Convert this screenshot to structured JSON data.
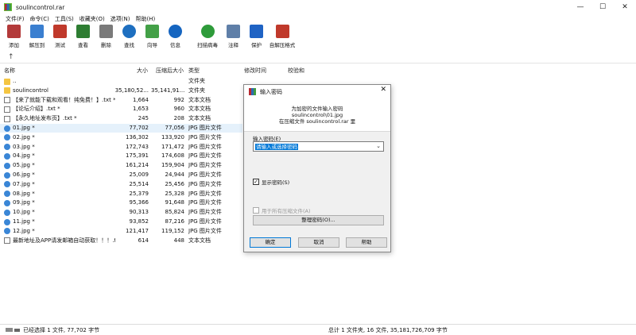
{
  "window": {
    "title": "soulincontrol.rar",
    "min": "—",
    "max": "☐",
    "close": "✕"
  },
  "menu": [
    "文件(F)",
    "命令(C)",
    "工具(S)",
    "收藏夹(O)",
    "选项(N)",
    "帮助(H)"
  ],
  "toolbar": [
    {
      "label": "添加",
      "icon": "add-archive-icon",
      "color": "#b33a3a"
    },
    {
      "label": "解压到",
      "icon": "extract-folder-icon",
      "color": "#3a7fd0"
    },
    {
      "label": "测试",
      "icon": "test-icon",
      "color": "#c0392b"
    },
    {
      "label": "查看",
      "icon": "view-book-icon",
      "color": "#2e7d32"
    },
    {
      "label": "删除",
      "icon": "trash-icon",
      "color": "#7a7a7a"
    },
    {
      "label": "查找",
      "icon": "find-magnifier-icon",
      "color": "#1e6fc0"
    },
    {
      "label": "向导",
      "icon": "wizard-wand-icon",
      "color": "#43a047"
    },
    {
      "label": "信息",
      "icon": "info-icon",
      "color": "#1565c0"
    },
    {
      "label": "扫描病毒",
      "icon": "virus-scan-icon",
      "color": "#2e9b3a"
    },
    {
      "label": "注释",
      "icon": "comment-icon",
      "color": "#5f7fa8"
    },
    {
      "label": "保护",
      "icon": "shield-icon",
      "color": "#1f63c4"
    },
    {
      "label": "自解压格式",
      "icon": "sfx-icon",
      "color": "#c0392b"
    }
  ],
  "columns": {
    "name": "名称",
    "size": "大小",
    "packed": "压缩后大小",
    "type": "类型",
    "modified": "修改时间",
    "crc": "校验和"
  },
  "files": [
    {
      "name": "..",
      "size": "",
      "packed": "",
      "type": "文件夹",
      "kind": "folder"
    },
    {
      "name": "soulincontrol",
      "size": "35,180,52...",
      "packed": "35,141,91...",
      "type": "文件夹",
      "kind": "folder"
    },
    {
      "name": "【来了就能下载和观看！纯免费！】.txt *",
      "size": "1,664",
      "packed": "992",
      "type": "文本文档",
      "kind": "txt"
    },
    {
      "name": "【论坛介绍】.txt *",
      "size": "1,653",
      "packed": "960",
      "type": "文本文档",
      "kind": "txt"
    },
    {
      "name": "【永久地址发布页】.txt *",
      "size": "245",
      "packed": "208",
      "type": "文本文档",
      "kind": "txt"
    },
    {
      "name": "01.jpg *",
      "size": "77,702",
      "packed": "77,056",
      "type": "JPG 图片文件",
      "kind": "jpg"
    },
    {
      "name": "02.jpg *",
      "size": "136,302",
      "packed": "133,920",
      "type": "JPG 图片文件",
      "kind": "jpg"
    },
    {
      "name": "03.jpg *",
      "size": "172,743",
      "packed": "171,472",
      "type": "JPG 图片文件",
      "kind": "jpg"
    },
    {
      "name": "04.jpg *",
      "size": "175,391",
      "packed": "174,608",
      "type": "JPG 图片文件",
      "kind": "jpg"
    },
    {
      "name": "05.jpg *",
      "size": "161,214",
      "packed": "159,904",
      "type": "JPG 图片文件",
      "kind": "jpg"
    },
    {
      "name": "06.jpg *",
      "size": "25,009",
      "packed": "24,944",
      "type": "JPG 图片文件",
      "kind": "jpg"
    },
    {
      "name": "07.jpg *",
      "size": "25,514",
      "packed": "25,456",
      "type": "JPG 图片文件",
      "kind": "jpg"
    },
    {
      "name": "08.jpg *",
      "size": "25,379",
      "packed": "25,328",
      "type": "JPG 图片文件",
      "kind": "jpg"
    },
    {
      "name": "09.jpg *",
      "size": "95,366",
      "packed": "91,648",
      "type": "JPG 图片文件",
      "kind": "jpg"
    },
    {
      "name": "10.jpg *",
      "size": "90,313",
      "packed": "85,824",
      "type": "JPG 图片文件",
      "kind": "jpg"
    },
    {
      "name": "11.jpg *",
      "size": "93,852",
      "packed": "87,216",
      "type": "JPG 图片文件",
      "kind": "jpg"
    },
    {
      "name": "12.jpg *",
      "size": "121,417",
      "packed": "119,152",
      "type": "JPG 图片文件",
      "kind": "jpg"
    },
    {
      "name": "最新地址及APP请发邮箱自动获取！！！.t...",
      "size": "614",
      "packed": "448",
      "type": "文本文档",
      "kind": "txt"
    }
  ],
  "selected_row": 5,
  "status": {
    "left": "已经选择 1 文件, 77,702 字节",
    "right": "总计 1 文件夹, 16 文件, 35,181,726,709 字节"
  },
  "dialog": {
    "title": "输入密码",
    "close": "✕",
    "line1": "为加密的文件输入密码",
    "line2": "soulincontrol\\01.jpg",
    "line3": "在压缩文件 soulincontrol.rar 里",
    "password_label": "输入密码(E)",
    "password_value": "请输入或选择密码",
    "show_password": "显示密码(S)",
    "show_password_checked": true,
    "use_all": "用于所有压缩文件(A)",
    "use_all_checked": false,
    "organize": "整理密码(O)...",
    "ok": "确定",
    "cancel": "取消",
    "help": "帮助"
  },
  "up_arrow": "↑"
}
